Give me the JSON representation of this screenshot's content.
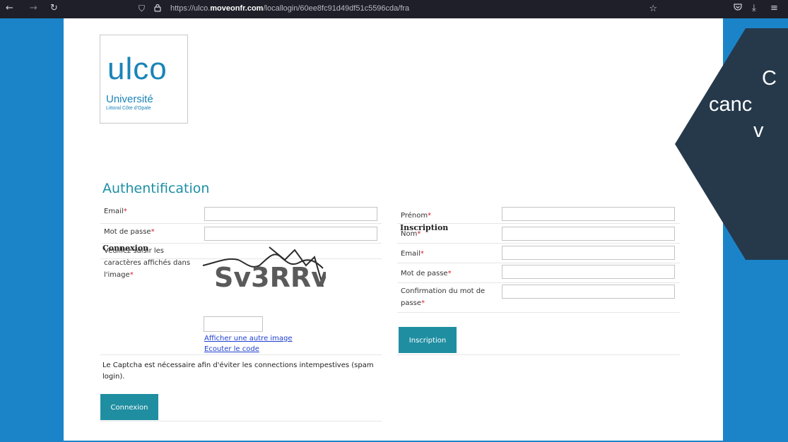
{
  "browser": {
    "url_prefix": "https://ulco.",
    "url_domain": "moveonfr.com",
    "url_path": "/locallogin/60ee8fc91d49df51c5596cda/fra"
  },
  "logo": {
    "wordmark": "ulco",
    "name": "Université",
    "tagline": "Littoral Côte d'Opale"
  },
  "page_title": "Authentification",
  "connexion": {
    "heading": "Connexion",
    "email_label": "Email",
    "password_label": "Mot de passe",
    "captcha_label": "Veuillez saisir les caractères affichés dans l'image",
    "captcha_text": "Sv3RRv",
    "other_image_link": "Afficher une autre image",
    "listen_code_link": "Ecouter le code",
    "captcha_note": "Le Captcha est nécessaire afin d'éviter les connections intempestives (spam login).",
    "submit_label": "Connexion"
  },
  "inscription": {
    "heading": "Inscription",
    "firstname_label": "Prénom",
    "lastname_label": "Nom",
    "email_label": "Email",
    "password_label": "Mot de passe",
    "confirm_label": "Confirmation du mot de passe",
    "submit_label": "Inscription"
  },
  "required_marker": "*",
  "overlay": {
    "line1": "C",
    "line2": "canc",
    "line3": "v"
  },
  "colors": {
    "background": "#1b84c9",
    "accent": "#1f8ea1",
    "callout": "#26394b",
    "required": "#d21f2a"
  }
}
